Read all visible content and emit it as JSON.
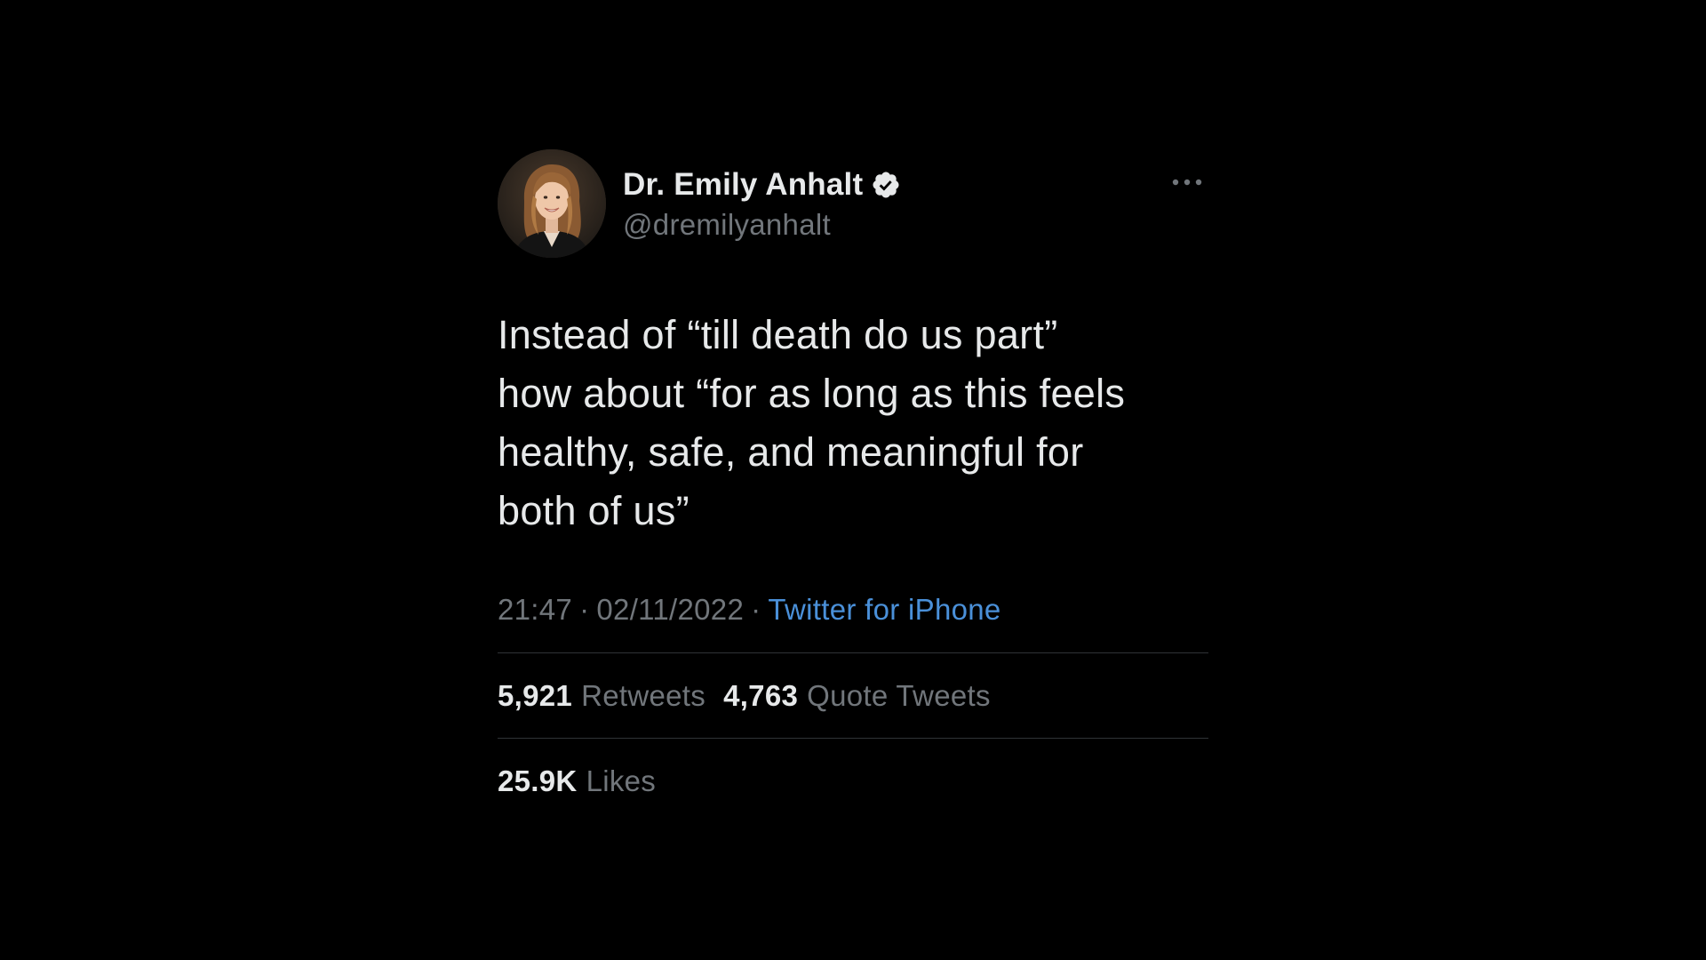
{
  "author": {
    "display_name": "Dr. Emily Anhalt",
    "handle": "@dremilyanhalt",
    "verified_icon": "verified-badge-icon",
    "avatar": "profile-photo"
  },
  "menu_icon": "more-options-icon",
  "tweet": {
    "text": "Instead of “till death do us part”\nhow about “for as long as this feels\nhealthy, safe, and meaningful for\nboth of us”"
  },
  "meta": {
    "time": "21:47",
    "separator": "·",
    "date": "02/11/2022",
    "source": "Twitter for iPhone"
  },
  "stats": {
    "retweets": {
      "count": "5,921",
      "label": "Retweets"
    },
    "quote_tweets": {
      "count": "4,763",
      "label": "Quote Tweets"
    },
    "likes": {
      "count": "25.9K",
      "label": "Likes"
    }
  },
  "colors": {
    "background": "#000000",
    "primary_text": "#e7e9ea",
    "secondary_text": "#71767b",
    "link": "#4a90d9",
    "divider": "#2f3336"
  }
}
